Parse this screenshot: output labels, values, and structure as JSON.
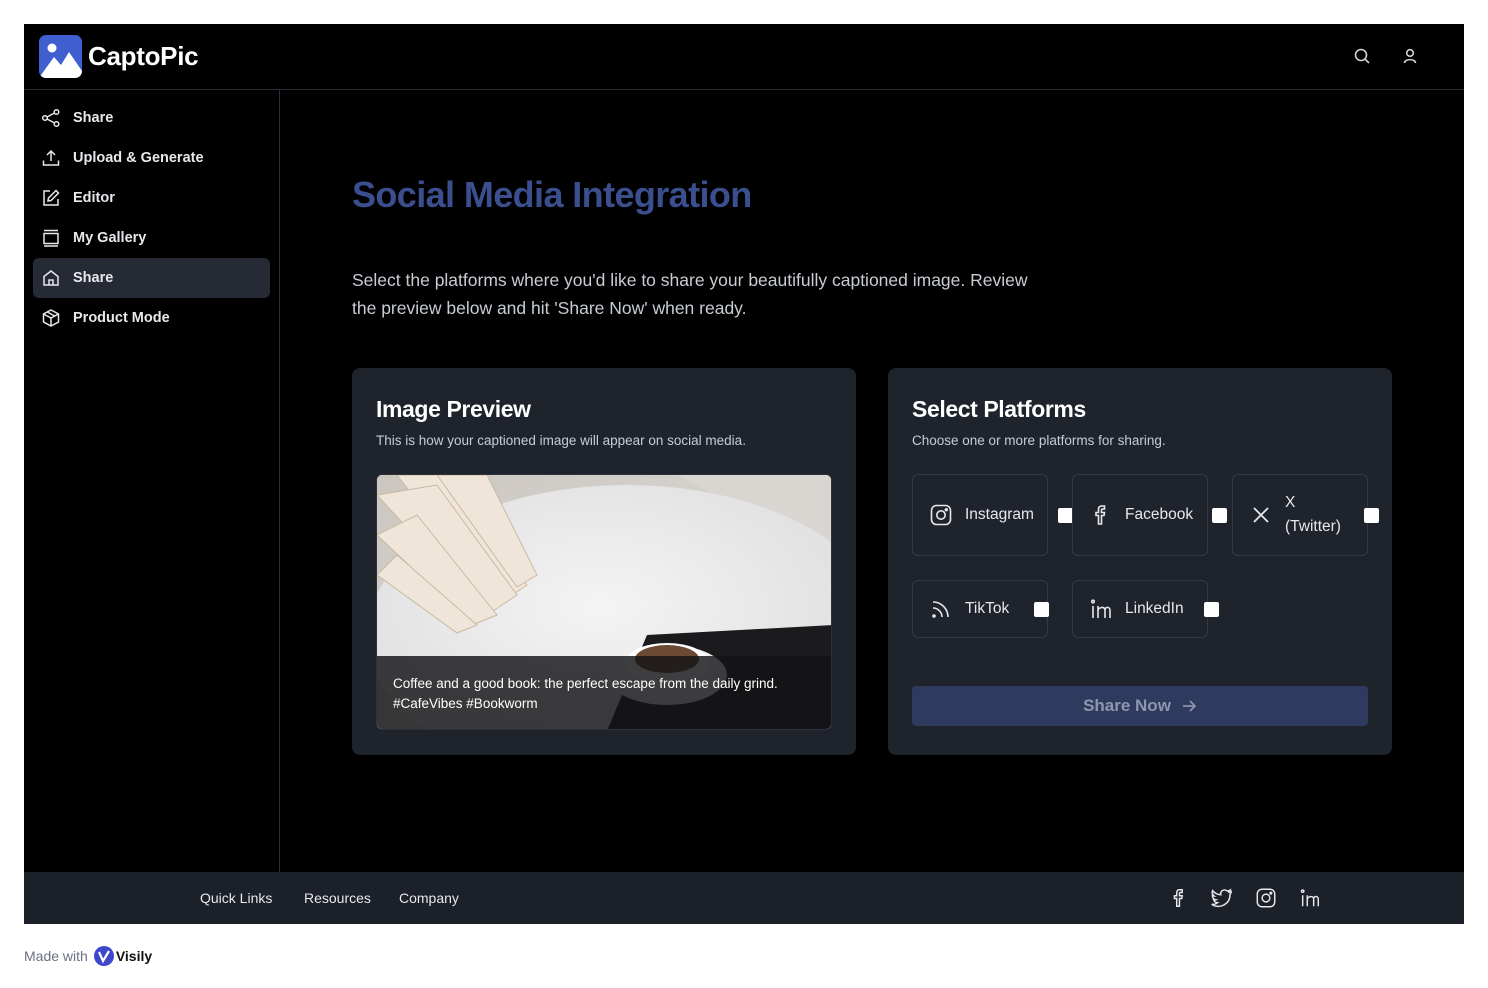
{
  "app": {
    "name": "CaptoPic"
  },
  "sidebar": {
    "items": [
      {
        "label": "Share",
        "icon": "share-icon"
      },
      {
        "label": "Upload & Generate",
        "icon": "upload-icon"
      },
      {
        "label": "Editor",
        "icon": "edit-icon"
      },
      {
        "label": "My Gallery",
        "icon": "gallery-icon"
      },
      {
        "label": "Share",
        "icon": "home-icon",
        "active": true
      },
      {
        "label": "Product Mode",
        "icon": "box-icon"
      }
    ]
  },
  "main": {
    "title": "Social Media Integration",
    "intro": "Select the platforms where you'd like to share your beautifully captioned image. Review the preview below and hit 'Share Now' when ready.",
    "preview_card": {
      "title": "Image Preview",
      "subtitle": "This is how your captioned image will appear on social media.",
      "caption_line1": "Coffee and a good book: the perfect escape from the daily grind.",
      "caption_line2": "#CafeVibes #Bookworm"
    },
    "platforms_card": {
      "title": "Select Platforms",
      "subtitle": "Choose one or more platforms for sharing.",
      "platforms": [
        {
          "label": "Instagram",
          "checked": false
        },
        {
          "label": "Facebook",
          "checked": false
        },
        {
          "label": "X",
          "label2": "(Twitter)",
          "checked": false
        },
        {
          "label": "TikTok",
          "checked": false
        },
        {
          "label": "LinkedIn",
          "checked": false
        }
      ],
      "share_button": "Share Now"
    }
  },
  "footer": {
    "links": [
      "Quick Links",
      "Resources",
      "Company"
    ],
    "social_icons": [
      "facebook-icon",
      "twitter-icon",
      "instagram-icon",
      "linkedin-icon"
    ]
  },
  "badge": {
    "made_with": "Made with",
    "brand": "Visily"
  },
  "colors": {
    "accent": "#3b4f8f",
    "card_bg": "#1f232b",
    "sidebar_active": "#252a34",
    "button": "#2e3a5e",
    "logo": "#3f5fd1"
  }
}
